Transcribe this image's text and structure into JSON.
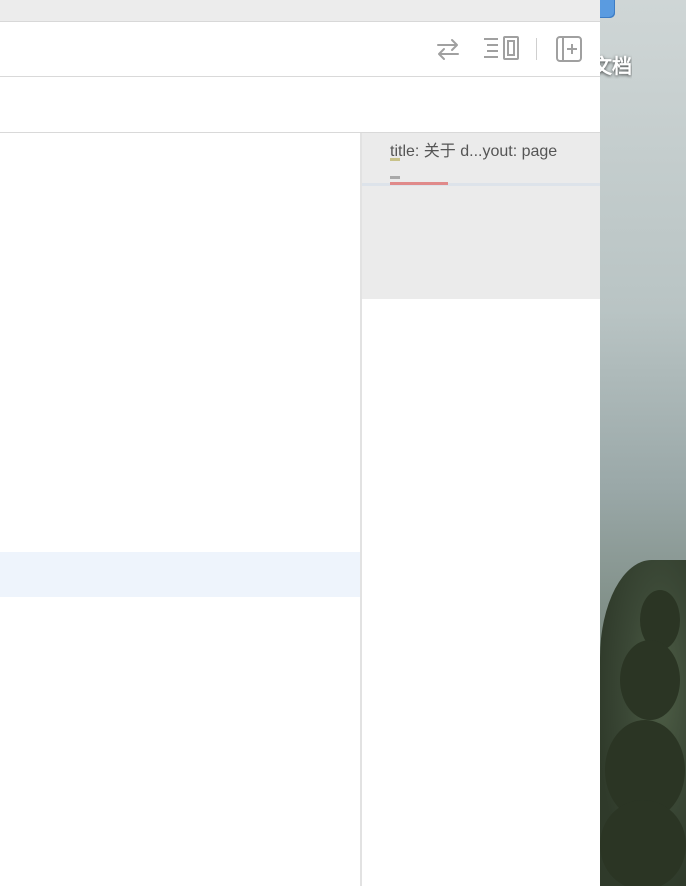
{
  "desktop": {
    "label": "文档",
    "icons": [
      "folder-icon"
    ]
  },
  "toolbar": {
    "icons": [
      "swap-arrows-icon",
      "outline-toggle-icon",
      "add-pane-icon"
    ]
  },
  "minimap": {
    "summary_text": "title: 关于 d...yout: page",
    "colors": {
      "yellow_mark": "#c8c28a",
      "gray_mark": "#a9a9a9",
      "red_mark": "#e08a8a",
      "viewport_bg": "#ebebeb"
    }
  },
  "editor": {
    "selected_line_color": "#eef4fc"
  }
}
